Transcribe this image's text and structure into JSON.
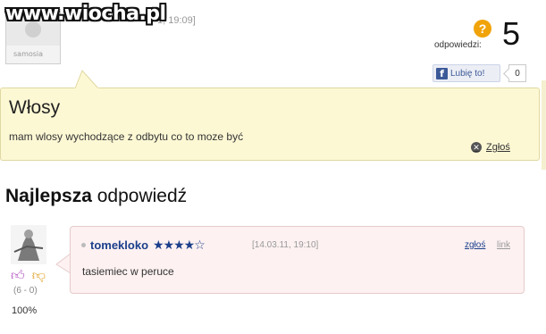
{
  "watermark": "www.wiocha.pl",
  "question": {
    "avatar_label": "samosia",
    "date": "1, 19:09]",
    "answers_label": "odpowiedzi:",
    "answers_count": "5",
    "like_label": "Lubię to!",
    "like_count": "0",
    "title": "Włosy",
    "text": "mam wlosy wychodzące z odbytu co to moze być",
    "report_label": "Zgłoś"
  },
  "best_answer": {
    "heading_bold": "Najlepsza",
    "heading_rest": " odpowiedź",
    "votes": "(6 - 0)",
    "percent": "100%",
    "username": "tomekloko",
    "stars": "★★★★☆",
    "date": "[14.03.11, 19:10]",
    "report_label": "zgłoś",
    "link_label": "link",
    "text": "tasiemiec w peruce"
  },
  "colors": {
    "question_bg": "#fdf8d4",
    "answer_bg": "#fdf1f1",
    "username": "#1b3f8b",
    "badge": "#f0a30a",
    "facebook": "#3b5998"
  },
  "icons": [
    "question-badge-icon",
    "facebook-icon",
    "close-circle-icon",
    "thumb-up-icon",
    "thumb-down-icon",
    "star-rating-icon"
  ]
}
